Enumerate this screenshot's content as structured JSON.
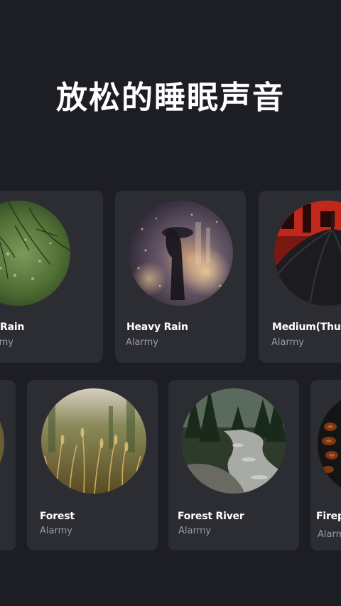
{
  "headline": "放松的睡眠声音",
  "rows": [
    {
      "cards": [
        {
          "title": "Rain",
          "subtitle": "Alarmy",
          "art": "rainy-leaves-image"
        },
        {
          "title": "Heavy Rain",
          "subtitle": "Alarmy",
          "art": "rainy-street-window-image"
        },
        {
          "title": "Medium(Thun",
          "subtitle": "Alarmy",
          "art": "black-umbrella-image"
        }
      ]
    },
    {
      "cards": [
        {
          "title": "",
          "subtitle": "",
          "art": "partial-card-image"
        },
        {
          "title": "Forest",
          "subtitle": "Alarmy",
          "art": "forest-grass-image"
        },
        {
          "title": "Forest River",
          "subtitle": "Alarmy",
          "art": "forest-river-image"
        },
        {
          "title": "Firepl",
          "subtitle": "Alarmy",
          "art": "fireplace-image"
        }
      ]
    }
  ]
}
